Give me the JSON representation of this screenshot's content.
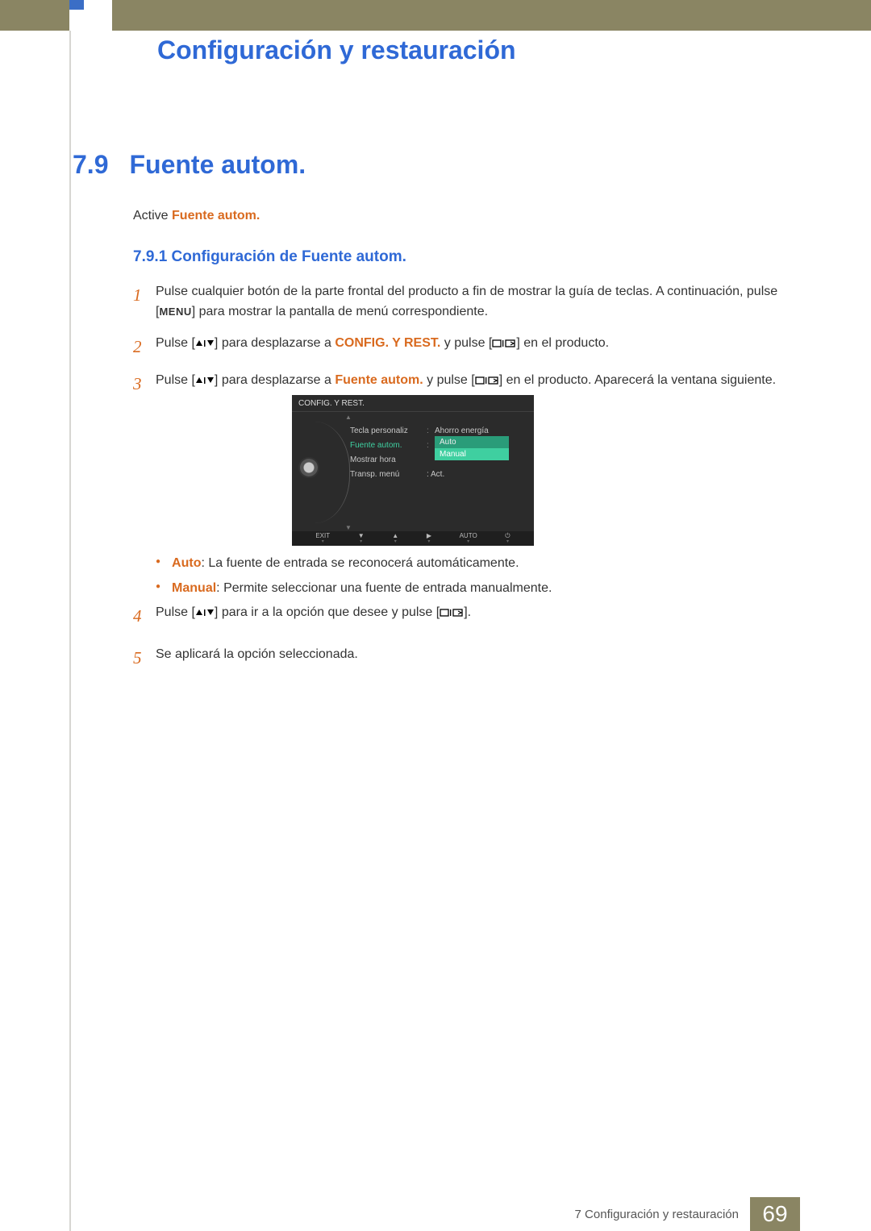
{
  "chapter_title": "Configuración y restauración",
  "section": {
    "num": "7.9",
    "title": "Fuente autom."
  },
  "intro": {
    "prefix": "Active ",
    "highlight": "Fuente autom."
  },
  "subsection": "7.9.1  Configuración de Fuente autom.",
  "steps": {
    "s1": {
      "num": "1",
      "a": "Pulse cualquier botón de la parte frontal del producto a fin de mostrar la guía de teclas. A continuación, pulse [",
      "menu": "MENU",
      "b": "] para mostrar la pantalla de menú correspondiente."
    },
    "s2": {
      "num": "2",
      "a": "Pulse [",
      "b": "] para desplazarse a ",
      "hl": "CONFIG. Y REST.",
      "c": " y pulse [",
      "d": "] en el producto."
    },
    "s3": {
      "num": "3",
      "a": "Pulse [",
      "b": "] para desplazarse a ",
      "hl": "Fuente autom.",
      "c": " y pulse [",
      "d": "] en el producto. Aparecerá la ventana siguiente."
    },
    "s4": {
      "num": "4",
      "a": "Pulse [",
      "b": "] para ir a la opción que desee y pulse [",
      "c": "]."
    },
    "s5": {
      "num": "5",
      "a": "Se aplicará la opción seleccionada."
    }
  },
  "bullets": {
    "b1": {
      "hl": "Auto",
      "rest": ": La fuente de entrada se reconocerá automáticamente."
    },
    "b2": {
      "hl": "Manual",
      "rest": ": Permite seleccionar una fuente de entrada manualmente."
    }
  },
  "osd": {
    "title": "CONFIG. Y REST.",
    "rows": [
      {
        "label": "Tecla personaliz",
        "val": "Ahorro energía"
      },
      {
        "label": "Fuente autom.",
        "val": ""
      },
      {
        "label": "Mostrar hora",
        "val": ""
      },
      {
        "label": "Transp. menú",
        "val": ": Act."
      }
    ],
    "dropdown": {
      "opt1": "Auto",
      "opt2": "Manual"
    },
    "footer": {
      "exit": "EXIT",
      "auto": "AUTO"
    }
  },
  "footer": {
    "text": "7 Configuración y restauración",
    "page": "69"
  }
}
